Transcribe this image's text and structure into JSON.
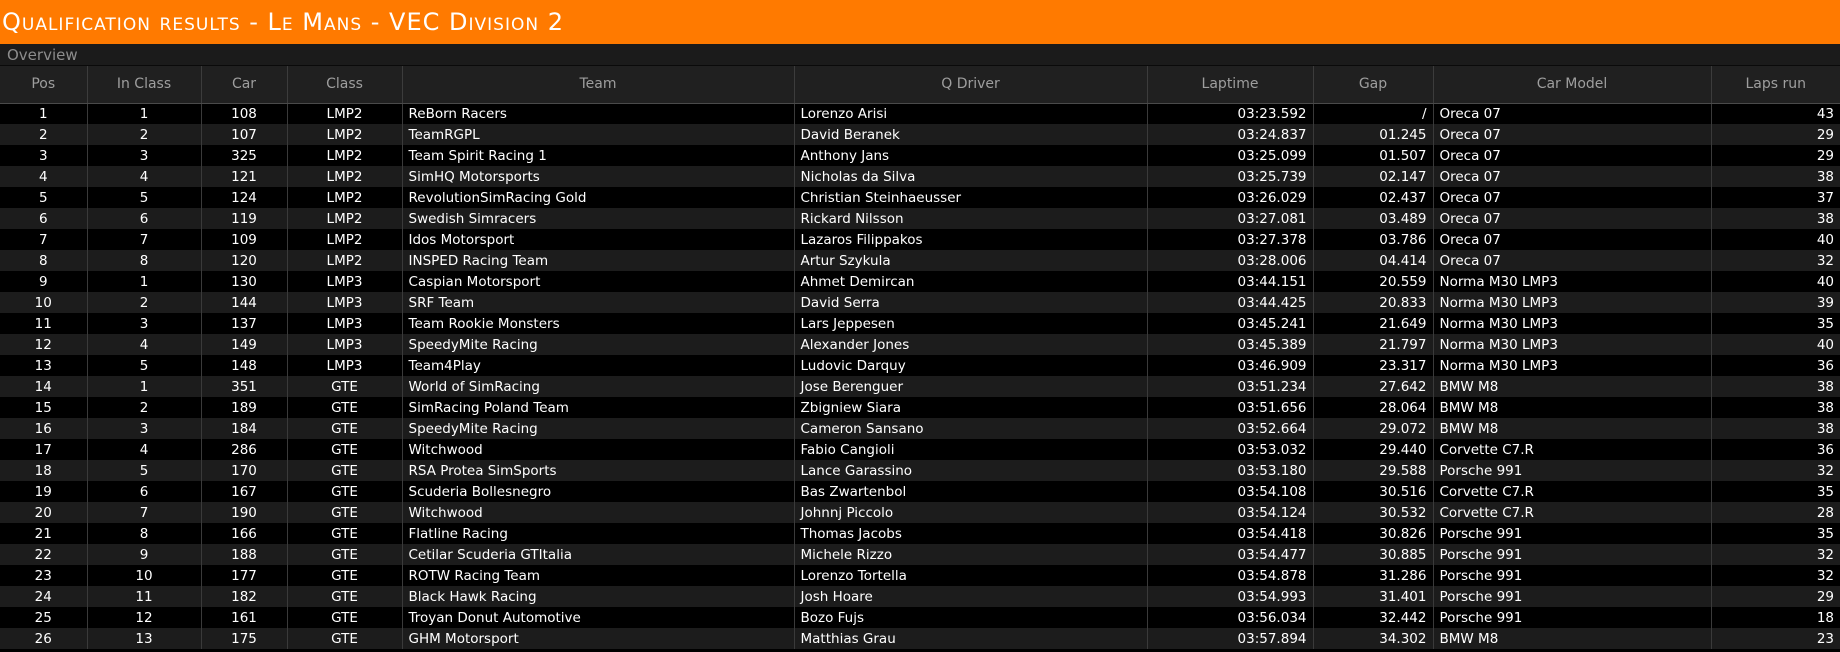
{
  "title": "Qualification results - Le Mans - VEC Division 2",
  "section": "Overview",
  "columns": [
    "Pos",
    "In Class",
    "Car",
    "Class",
    "Team",
    "Q Driver",
    "Laptime",
    "Gap",
    "Car Model",
    "Laps run"
  ],
  "rows": [
    [
      "1",
      "1",
      "108",
      "LMP2",
      "ReBorn Racers",
      "Lorenzo Arisi",
      "03:23.592",
      "/",
      "Oreca 07",
      "43"
    ],
    [
      "2",
      "2",
      "107",
      "LMP2",
      "TeamRGPL",
      "David Beranek",
      "03:24.837",
      "01.245",
      "Oreca 07",
      "29"
    ],
    [
      "3",
      "3",
      "325",
      "LMP2",
      "Team Spirit Racing 1",
      "Anthony Jans",
      "03:25.099",
      "01.507",
      "Oreca 07",
      "29"
    ],
    [
      "4",
      "4",
      "121",
      "LMP2",
      "SimHQ Motorsports",
      "Nicholas da Silva",
      "03:25.739",
      "02.147",
      "Oreca 07",
      "38"
    ],
    [
      "5",
      "5",
      "124",
      "LMP2",
      "RevolutionSimRacing Gold",
      "Christian Steinhaeusser",
      "03:26.029",
      "02.437",
      "Oreca 07",
      "37"
    ],
    [
      "6",
      "6",
      "119",
      "LMP2",
      "Swedish Simracers",
      "Rickard Nilsson",
      "03:27.081",
      "03.489",
      "Oreca 07",
      "38"
    ],
    [
      "7",
      "7",
      "109",
      "LMP2",
      "Idos Motorsport",
      "Lazaros Filippakos",
      "03:27.378",
      "03.786",
      "Oreca 07",
      "40"
    ],
    [
      "8",
      "8",
      "120",
      "LMP2",
      "INSPED Racing Team",
      "Artur Szykula",
      "03:28.006",
      "04.414",
      "Oreca 07",
      "32"
    ],
    [
      "9",
      "1",
      "130",
      "LMP3",
      "Caspian Motorsport",
      "Ahmet Demircan",
      "03:44.151",
      "20.559",
      "Norma M30 LMP3",
      "40"
    ],
    [
      "10",
      "2",
      "144",
      "LMP3",
      "SRF Team",
      "David Serra",
      "03:44.425",
      "20.833",
      "Norma M30 LMP3",
      "39"
    ],
    [
      "11",
      "3",
      "137",
      "LMP3",
      "Team Rookie Monsters",
      "Lars Jeppesen",
      "03:45.241",
      "21.649",
      "Norma M30 LMP3",
      "35"
    ],
    [
      "12",
      "4",
      "149",
      "LMP3",
      "SpeedyMite Racing",
      "Alexander Jones",
      "03:45.389",
      "21.797",
      "Norma M30 LMP3",
      "40"
    ],
    [
      "13",
      "5",
      "148",
      "LMP3",
      "Team4Play",
      "Ludovic Darquy",
      "03:46.909",
      "23.317",
      "Norma M30 LMP3",
      "36"
    ],
    [
      "14",
      "1",
      "351",
      "GTE",
      "World of SimRacing",
      "Jose Berenguer",
      "03:51.234",
      "27.642",
      "BMW M8",
      "38"
    ],
    [
      "15",
      "2",
      "189",
      "GTE",
      "SimRacing Poland Team",
      "Zbigniew Siara",
      "03:51.656",
      "28.064",
      "BMW M8",
      "38"
    ],
    [
      "16",
      "3",
      "184",
      "GTE",
      "SpeedyMite Racing",
      "Cameron Sansano",
      "03:52.664",
      "29.072",
      "BMW M8",
      "38"
    ],
    [
      "17",
      "4",
      "286",
      "GTE",
      "Witchwood",
      "Fabio Cangioli",
      "03:53.032",
      "29.440",
      "Corvette C7.R",
      "36"
    ],
    [
      "18",
      "5",
      "170",
      "GTE",
      "RSA Protea SimSports",
      "Lance Garassino",
      "03:53.180",
      "29.588",
      "Porsche 991",
      "32"
    ],
    [
      "19",
      "6",
      "167",
      "GTE",
      "Scuderia Bollesnegro",
      "Bas Zwartenbol",
      "03:54.108",
      "30.516",
      "Corvette C7.R",
      "35"
    ],
    [
      "20",
      "7",
      "190",
      "GTE",
      "Witchwood",
      "Johnnj Piccolo",
      "03:54.124",
      "30.532",
      "Corvette C7.R",
      "28"
    ],
    [
      "21",
      "8",
      "166",
      "GTE",
      "Flatline Racing",
      "Thomas Jacobs",
      "03:54.418",
      "30.826",
      "Porsche 991",
      "35"
    ],
    [
      "22",
      "9",
      "188",
      "GTE",
      "Cetilar Scuderia GTItalia",
      "Michele Rizzo",
      "03:54.477",
      "30.885",
      "Porsche 991",
      "32"
    ],
    [
      "23",
      "10",
      "177",
      "GTE",
      "ROTW Racing Team",
      "Lorenzo Tortella",
      "03:54.878",
      "31.286",
      "Porsche 991",
      "32"
    ],
    [
      "24",
      "11",
      "182",
      "GTE",
      "Black Hawk Racing",
      "Josh Hoare",
      "03:54.993",
      "31.401",
      "Porsche 991",
      "29"
    ],
    [
      "25",
      "12",
      "161",
      "GTE",
      "Troyan Donut Automotive",
      "Bozo Fujs",
      "03:56.034",
      "32.442",
      "Porsche 991",
      "18"
    ],
    [
      "26",
      "13",
      "175",
      "GTE",
      "GHM Motorsport",
      "Matthias Grau",
      "03:57.894",
      "34.302",
      "BMW M8",
      "23"
    ]
  ],
  "colors": {
    "title_bar": "#ff7a00",
    "header_bg": "#202020",
    "row_dark": "#000000",
    "row_light": "#1c1c1c"
  }
}
